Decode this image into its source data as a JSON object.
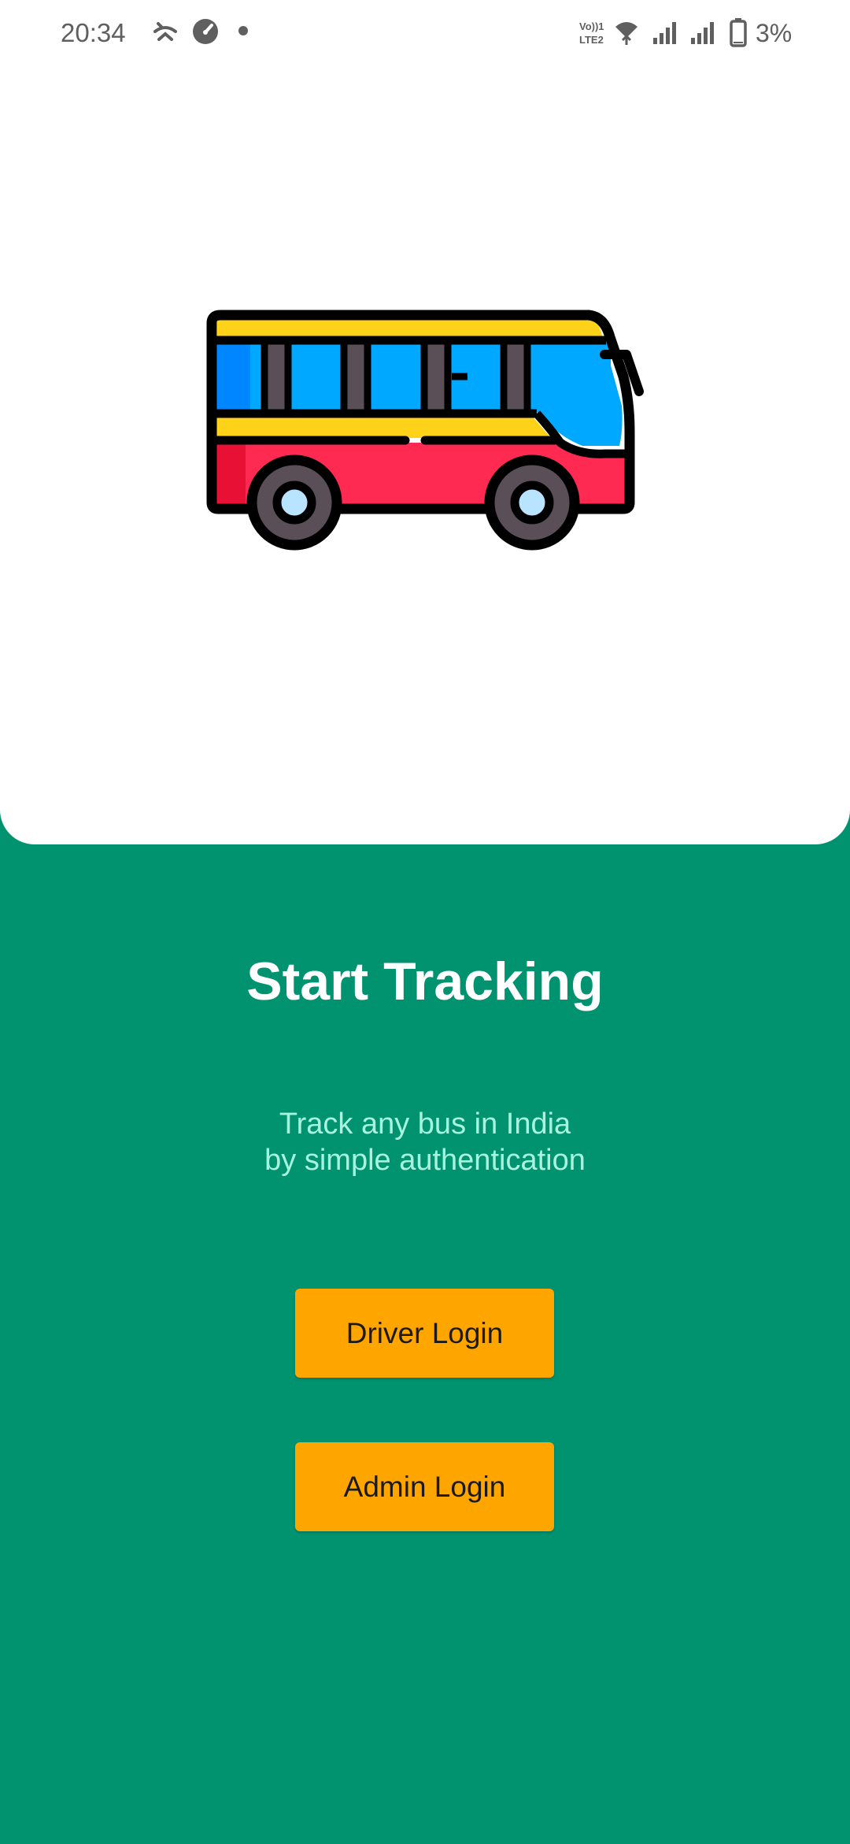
{
  "status_bar": {
    "time": "20:34",
    "battery_percent": "3%",
    "network_label_top": "Vo))1",
    "network_label_bottom": "LTE2",
    "icons": [
      "missed-call-icon",
      "speedometer-icon",
      "notification-dot-icon",
      "volte-icon",
      "wifi-icon",
      "signal-sim1-icon",
      "signal-sim2-icon",
      "battery-icon"
    ]
  },
  "hero": {
    "illustration": "bus-illustration"
  },
  "main": {
    "title": "Start Tracking",
    "subtitle_line1": "Track any bus in India",
    "subtitle_line2": "by simple authentication"
  },
  "buttons": {
    "driver_login": "Driver Login",
    "admin_login": "Admin Login"
  },
  "colors": {
    "background_green": "#01936f",
    "button_orange": "#ffa500",
    "subtitle_mint": "#a7f3e0",
    "panel_white": "#ffffff"
  }
}
